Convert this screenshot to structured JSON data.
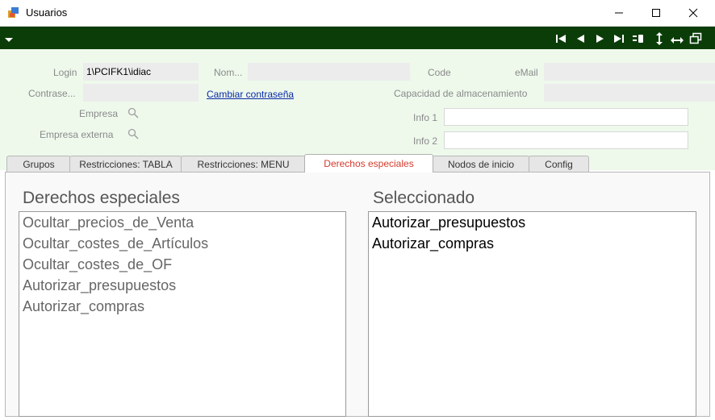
{
  "window": {
    "title": "Usuarios"
  },
  "form": {
    "login_label": "Login",
    "login_value": "1\\PCIFK1\\idiac",
    "nom_label": "Nom...",
    "nom_value": "",
    "code_label": "Code",
    "code_value": "",
    "email_label": "eMail",
    "email_value": "",
    "password_label": "Contrase...",
    "password_value": "",
    "change_password_link": "Cambiar contraseña",
    "storage_label": "Capacidad de almacenamiento",
    "storage_value": "",
    "empresa_label": "Empresa",
    "empresa_externa_label": "Empresa externa",
    "info1_label": "Info 1",
    "info1_value": "",
    "info2_label": "Info 2",
    "info2_value": ""
  },
  "tabs": [
    {
      "label": "Grupos"
    },
    {
      "label": "Restricciones: TABLA"
    },
    {
      "label": "Restricciones: MENU"
    },
    {
      "label": "Derechos especiales"
    },
    {
      "label": "Nodos de inicio"
    },
    {
      "label": "Config"
    }
  ],
  "active_tab": "Derechos especiales",
  "panel": {
    "left_title": "Derechos especiales",
    "right_title": "Seleccionado",
    "available_items": [
      "Ocultar_precios_de_Venta",
      "Ocultar_costes_de_Artículos",
      "Ocultar_costes_de_OF",
      "Autorizar_presupuestos",
      "Autorizar_compras"
    ],
    "selected_items": [
      "Autorizar_presupuestos",
      "Autorizar_compras"
    ]
  },
  "colors": {
    "toolbar_bg": "#0b3d08",
    "form_bg": "#eef9ec",
    "active_tab_text": "#d43b2e",
    "link": "#0a2aa8"
  },
  "icons": {
    "toolbar": [
      "first-record-icon",
      "previous-record-icon",
      "next-record-icon",
      "last-record-icon",
      "toggle-view-icon",
      "resize-vertical-icon",
      "resize-horizontal-icon",
      "restore-window-icon"
    ],
    "lookup": "magnifier-icon"
  }
}
